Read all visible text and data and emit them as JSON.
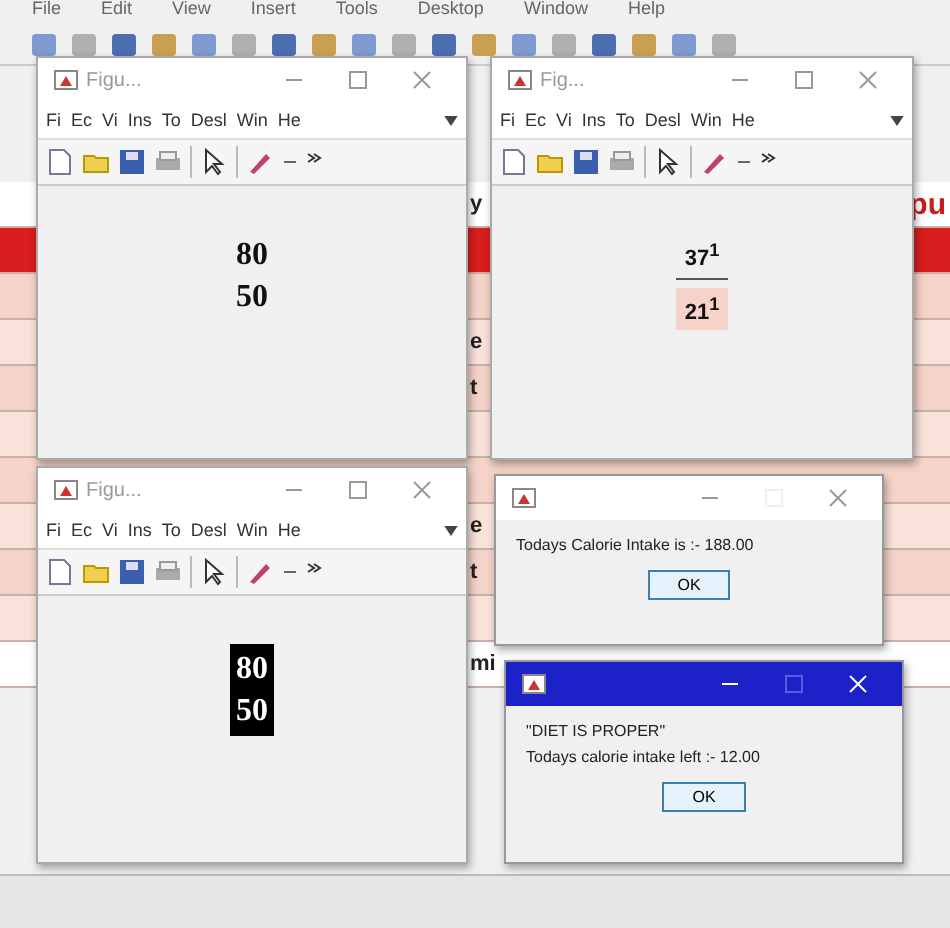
{
  "main_window": {
    "menu": [
      "File",
      "Edit",
      "View",
      "Insert",
      "Tools",
      "Desktop",
      "Window",
      "Help"
    ]
  },
  "background_rows": [
    {
      "left": "y",
      "right": "pu",
      "color": "#ffffff"
    },
    {
      "left": "",
      "right": "",
      "color": "#d81e1e"
    },
    {
      "left": "",
      "right": "",
      "color": "#f5d3c8"
    },
    {
      "left": "e",
      "right": "",
      "color": "#f8e2da"
    },
    {
      "left": "t",
      "right": "",
      "color": "#f5d3c8"
    },
    {
      "left": "",
      "right": "",
      "color": "#f8e2da"
    },
    {
      "left": "",
      "right": "",
      "color": "#f5d3c8"
    },
    {
      "left": "e",
      "right": "",
      "color": "#f8e2da"
    },
    {
      "left": "t",
      "right": "",
      "color": "#f5d3c8"
    },
    {
      "left": "",
      "right": "",
      "color": "#f8e2da"
    },
    {
      "left": "mi",
      "right": "",
      "color": "#ffffff"
    }
  ],
  "figures": [
    {
      "title": "Figu...",
      "menu": [
        "Fi",
        "Ec",
        "Vi",
        "Ins",
        "To",
        "Desl",
        "Win",
        "He"
      ],
      "kind": "plain",
      "lines": [
        "80",
        "50"
      ]
    },
    {
      "title": "Fig...",
      "menu": [
        "Fi",
        "Ec",
        "Vi",
        "Ins",
        "To",
        "Desl",
        "Win",
        "He"
      ],
      "kind": "fraction",
      "lines": [
        "37$^{1}$",
        "21$^{1}$"
      ]
    },
    {
      "title": "Figu...",
      "menu": [
        "Fi",
        "Ec",
        "Vi",
        "Ins",
        "To",
        "Desl",
        "Win",
        "He"
      ],
      "kind": "inverted",
      "lines": [
        "80",
        "50"
      ]
    }
  ],
  "dialogs": [
    {
      "active": false,
      "lines": [
        "Todays Calorie Intake is :- 188.00"
      ],
      "button": "OK"
    },
    {
      "active": true,
      "lines": [
        "\"DIET IS PROPER\"",
        "Todays calorie intake left :- 12.00"
      ],
      "button": "OK"
    }
  ]
}
